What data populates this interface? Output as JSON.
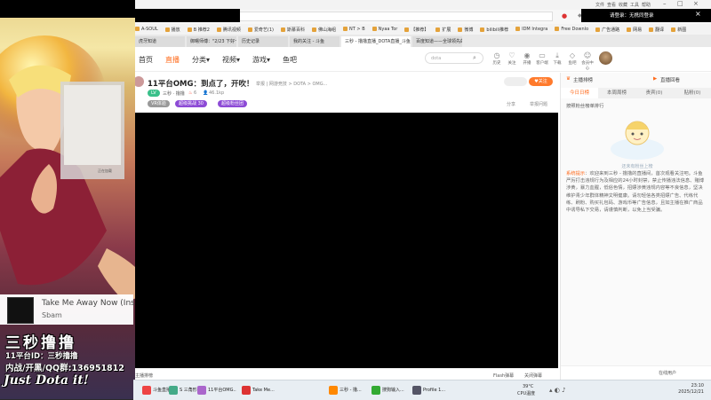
{
  "browser": {
    "url": "com/594839",
    "title_buttons": [
      "文件",
      "查看",
      "收藏",
      "工具",
      "帮助"
    ],
    "login_prompt": "请登录：无携同登录",
    "bookmarks": [
      "A-SOUL",
      "播放",
      "B 推荐2",
      "腾讯视频",
      "爱奇艺(1)",
      "斯慕百科",
      "佛山海组",
      "NT > B",
      "Nyaa Tor",
      "【推荐】",
      "扩展",
      "微博",
      "bilibili推荐",
      "IDM Integra",
      "Free Downlo",
      "广告通路",
      "网易",
      "翻译",
      "新图"
    ],
    "tabs": [
      "虎牙知道",
      "御曙师傅：\"2/23 下好一点\"",
      "历史记录",
      "我的关注 - 斗鱼",
      "三秒 - 撸撸直播_DOTA直播_斗鱼",
      "百度知道——全球领先的中文问答"
    ],
    "active_tab_index": 4
  },
  "site_nav": {
    "items": [
      "首页",
      "直播",
      "分类",
      "视频",
      "游戏",
      "鱼吧"
    ],
    "active_index": 1,
    "search_placeholder": "dota",
    "toolbar": [
      {
        "label": "历史",
        "icon": "clock-icon"
      },
      {
        "label": "关注",
        "icon": "heart-icon"
      },
      {
        "label": "开播",
        "icon": "camera-icon"
      },
      {
        "label": "客户端",
        "icon": "monitor-icon"
      },
      {
        "label": "下载",
        "icon": "download-icon"
      },
      {
        "label": "鱼吧",
        "icon": "fish-icon"
      },
      {
        "label": "会员中心",
        "icon": "user-icon"
      }
    ]
  },
  "room": {
    "title": "11平台OMG：到点了，开吹！",
    "category": "举报 | 网游竞技 > DOTA > OMG...",
    "streamer": "三秒 · 撸撸",
    "hot": "6",
    "viewers": "46.1kp",
    "badges": [
      "VR体验",
      "超级挑战 30",
      "超级粉丝团"
    ],
    "follow_label": "关注",
    "actions": [
      "分享",
      "举报问题"
    ]
  },
  "right_panel": {
    "header_left": "主播排榜",
    "header_right": "直播回看",
    "tabs": [
      "今日日榜",
      "本周周榜",
      "贵宾(0)",
      "贴粉(0)"
    ],
    "active_tab": 0,
    "rank_hint": "按照粉丝榜单排行",
    "empty_text": "还未有粉丝上榜",
    "system_label": "系统提示",
    "system_message": "：欢迎来到三秒 - 撸撸的直播间，首次观看关注吧。斗鱼严厉打击违规行为及相应的24小时封禁，禁止传播违法信息、赌博涉黄，暴力血腥，低俗色情，招嫖涉黄违规内容等不良信息，坚决维护青少年群体精神文明健康。请勿轻信各类招嫖广告、代练代练、刷粉、购买礼包码、游戏币等广告信息，且如主播在推广商品中诱导私下交易，请谨慎判断，以免上当受骗。",
    "footer": "在线用户"
  },
  "overlay": {
    "music_title": "Take Me Away Now (Ins",
    "music_artist": "Sbam",
    "stream_name": "三秒撸撸",
    "room_id": "11平台ID：三秒撸撸",
    "qq_group": "内战/开黑/QQ群:136951812",
    "slogan": "Just Dota it!"
  },
  "video_bottom": {
    "left_text": "主播排榜",
    "flash_text": "Flash弹幕",
    "close_text": "关闭弹幕"
  },
  "taskbar": {
    "tasks": [
      "斗鱼直播...",
      "S 三角形...",
      "11平台OMG...",
      "Take Me...",
      "三秒 - 撸...",
      "搜狗输入...",
      "Profile 1..."
    ],
    "weather": "39°C",
    "weather_sub": "CPU温度",
    "time": "23:10",
    "date": "2025/12/21"
  },
  "colors": {
    "accent": "#ff6a1a",
    "follow": "#ff7a2c",
    "badge_purple": "#8d4bd6",
    "badge_gray": "#999999",
    "badge_green": "#39c08a"
  }
}
